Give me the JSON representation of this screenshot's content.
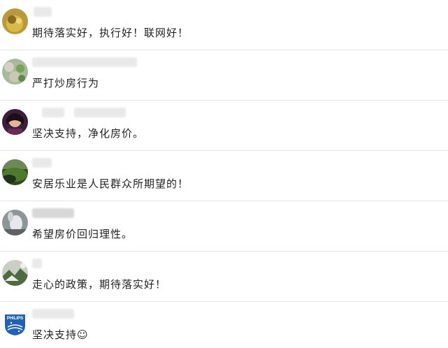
{
  "comments": [
    {
      "text": "期待落实好，执行好！联网好！",
      "avatar": "avatar-golden-animal"
    },
    {
      "text": "严打炒房行为",
      "avatar": "avatar-flowers-garden"
    },
    {
      "text": "坚决支持，净化房价。",
      "avatar": "avatar-woman-portrait"
    },
    {
      "text": "安居乐业是人民群众所期望的！",
      "avatar": "avatar-green-landscape"
    },
    {
      "text": "希望房价回归理性。",
      "avatar": "avatar-grey-animal"
    },
    {
      "text": "走心的政策，期待落实好！",
      "avatar": "avatar-rocks-nature"
    },
    {
      "text": "坚决支持☺",
      "avatar": "avatar-philips-logo"
    }
  ],
  "logo_text": "PHILIPS"
}
